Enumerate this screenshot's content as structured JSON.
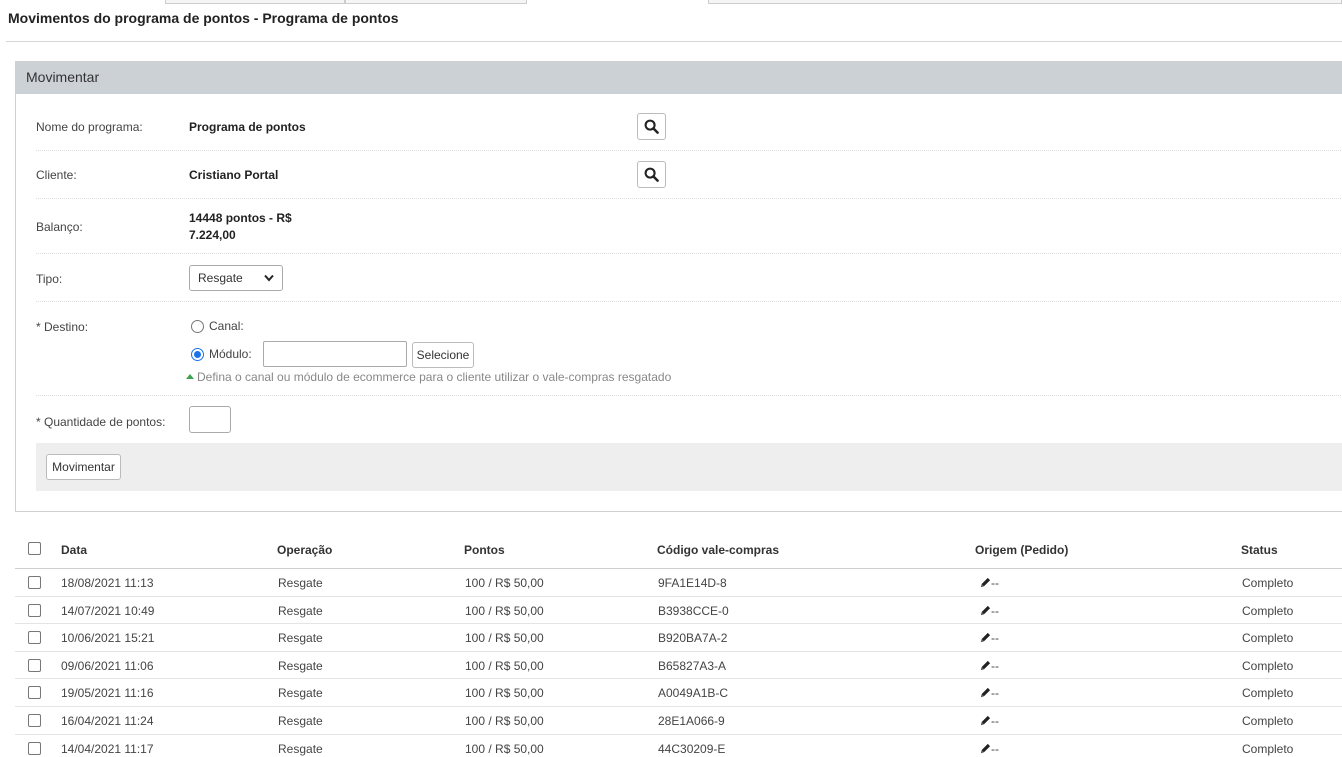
{
  "page": {
    "title": "Movimentos do programa de pontos - Programa de pontos"
  },
  "panel": {
    "header": "Movimentar",
    "program": {
      "label": "Nome do programa:",
      "value": "Programa de pontos"
    },
    "client": {
      "label": "Cliente:",
      "value": "Cristiano Portal"
    },
    "balance": {
      "label": "Balanço:",
      "line1": "14448 pontos - R$",
      "line2": "7.224,00"
    },
    "type": {
      "label": "Tipo:",
      "selected": "Resgate"
    },
    "destination": {
      "label": "* Destino:",
      "option_channel": "Canal:",
      "option_module": "Módulo:",
      "module_value": "",
      "select_button": "Selecione",
      "hint": "Defina o canal ou módulo de ecommerce para o cliente utilizar o vale-compras resgatado"
    },
    "quantity": {
      "label": "* Quantidade de pontos:",
      "value": ""
    },
    "submit_button": "Movimentar"
  },
  "table": {
    "headers": [
      "Data",
      "Operação",
      "Pontos",
      "Código vale-compras",
      "Origem (Pedido)",
      "Status"
    ],
    "rows": [
      {
        "date": "18/08/2021 11:13",
        "operation": "Resgate",
        "points": "100 / R$ 50,00",
        "code": "9FA1E14D-8",
        "origin": "--",
        "status": "Completo"
      },
      {
        "date": "14/07/2021 10:49",
        "operation": "Resgate",
        "points": "100 / R$ 50,00",
        "code": "B3938CCE-0",
        "origin": "--",
        "status": "Completo"
      },
      {
        "date": "10/06/2021 15:21",
        "operation": "Resgate",
        "points": "100 / R$ 50,00",
        "code": "B920BA7A-2",
        "origin": "--",
        "status": "Completo"
      },
      {
        "date": "09/06/2021 11:06",
        "operation": "Resgate",
        "points": "100 / R$ 50,00",
        "code": "B65827A3-A",
        "origin": "--",
        "status": "Completo"
      },
      {
        "date": "19/05/2021 11:16",
        "operation": "Resgate",
        "points": "100 / R$ 50,00",
        "code": "A0049A1B-C",
        "origin": "--",
        "status": "Completo"
      },
      {
        "date": "16/04/2021 11:24",
        "operation": "Resgate",
        "points": "100 / R$ 50,00",
        "code": "28E1A066-9",
        "origin": "--",
        "status": "Completo"
      },
      {
        "date": "14/04/2021 11:17",
        "operation": "Resgate",
        "points": "100 / R$ 50,00",
        "code": "44C30209-E",
        "origin": "--",
        "status": "Completo"
      }
    ]
  }
}
